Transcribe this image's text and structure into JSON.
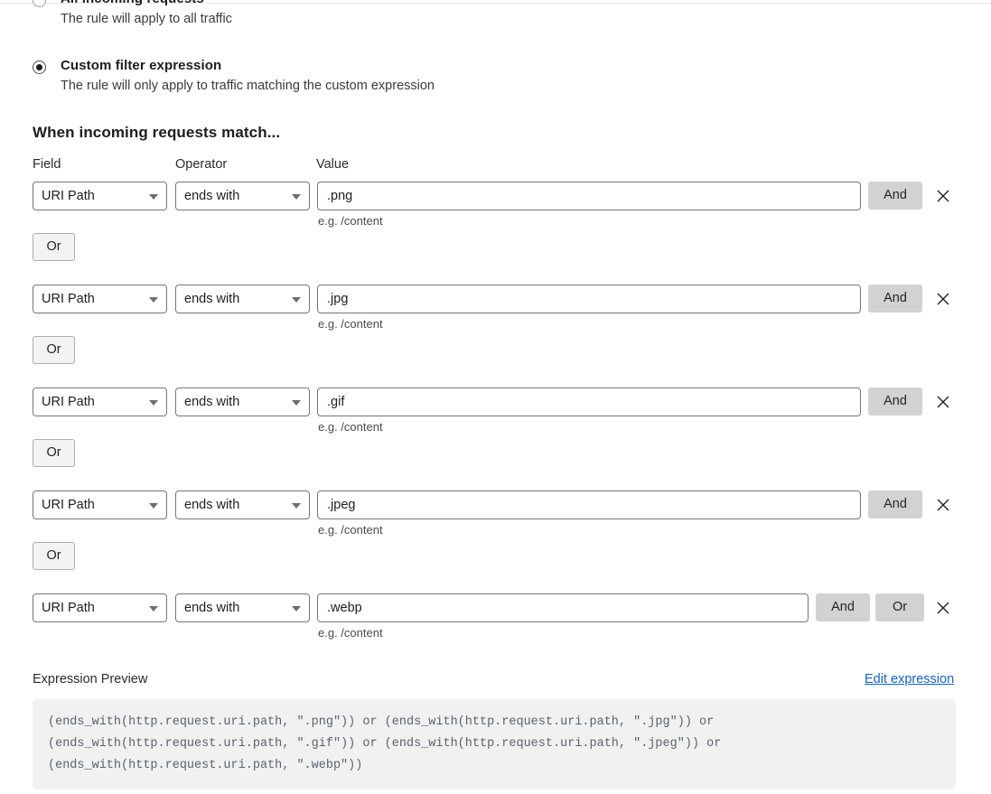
{
  "options": [
    {
      "id": "all-incoming-requests",
      "title": "All incoming requests",
      "description": "The rule will apply to all traffic",
      "selected": false
    },
    {
      "id": "custom-filter-expression",
      "title": "Custom filter expression",
      "description": "The rule will only apply to traffic matching the custom expression",
      "selected": true
    }
  ],
  "section": {
    "heading": "When incoming requests match..."
  },
  "columns": {
    "field": "Field",
    "operator": "Operator",
    "value": "Value"
  },
  "hint_text": "e.g. /content",
  "buttons": {
    "and": "And",
    "or": "Or",
    "close_icon": "close-icon",
    "or_separator": "Or"
  },
  "rows": [
    {
      "field": "URI Path",
      "operator": "ends with",
      "value": ".png",
      "and_label": "And",
      "or_label": null,
      "separator_label": "Or"
    },
    {
      "field": "URI Path",
      "operator": "ends with",
      "value": ".jpg",
      "and_label": "And",
      "or_label": null,
      "separator_label": "Or"
    },
    {
      "field": "URI Path",
      "operator": "ends with",
      "value": ".gif",
      "and_label": "And",
      "or_label": null,
      "separator_label": "Or"
    },
    {
      "field": "URI Path",
      "operator": "ends with",
      "value": ".jpeg",
      "and_label": "And",
      "or_label": null,
      "separator_label": "Or"
    },
    {
      "field": "URI Path",
      "operator": "ends with",
      "value": ".webp",
      "and_label": "And",
      "or_label": "Or",
      "separator_label": null
    }
  ],
  "preview": {
    "label": "Expression Preview",
    "edit_link": "Edit expression",
    "lines": [
      "(ends_with(http.request.uri.path, \".png\")) or (ends_with(http.request.uri.path, \".jpg\")) or",
      "(ends_with(http.request.uri.path, \".gif\")) or (ends_with(http.request.uri.path, \".jpeg\")) or",
      "(ends_with(http.request.uri.path, \".webp\"))"
    ]
  },
  "colors": {
    "link": "#1463c6",
    "button_gray": "#d2d2d2",
    "code_background": "#f1f1f1",
    "border": "#767676"
  }
}
